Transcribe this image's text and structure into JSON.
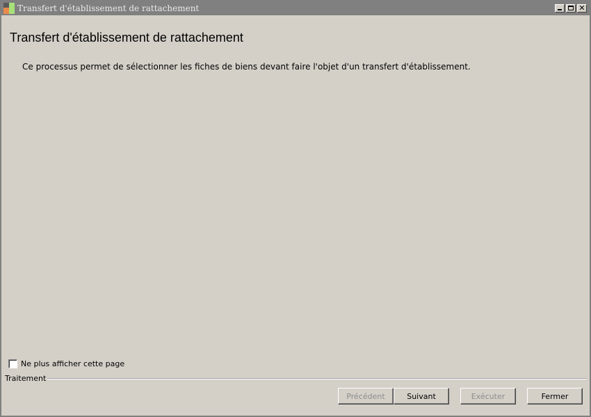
{
  "window": {
    "title": "Transfert d'établissement de rattachement",
    "controls": {
      "minimize": "minimize-icon",
      "maximize": "maximize-icon",
      "close": "close-icon"
    }
  },
  "main": {
    "heading": "Transfert d'établissement de rattachement",
    "description": "Ce processus permet de sélectionner les fiches de biens devant faire l'objet d'un transfert d'établissement."
  },
  "options": {
    "dont_show_label": "Ne plus afficher cette page",
    "dont_show_checked": false
  },
  "footer": {
    "group_label": "Traitement",
    "buttons": {
      "previous": "Précédent",
      "next": "Suivant",
      "execute": "Exécuter",
      "close": "Fermer"
    }
  }
}
